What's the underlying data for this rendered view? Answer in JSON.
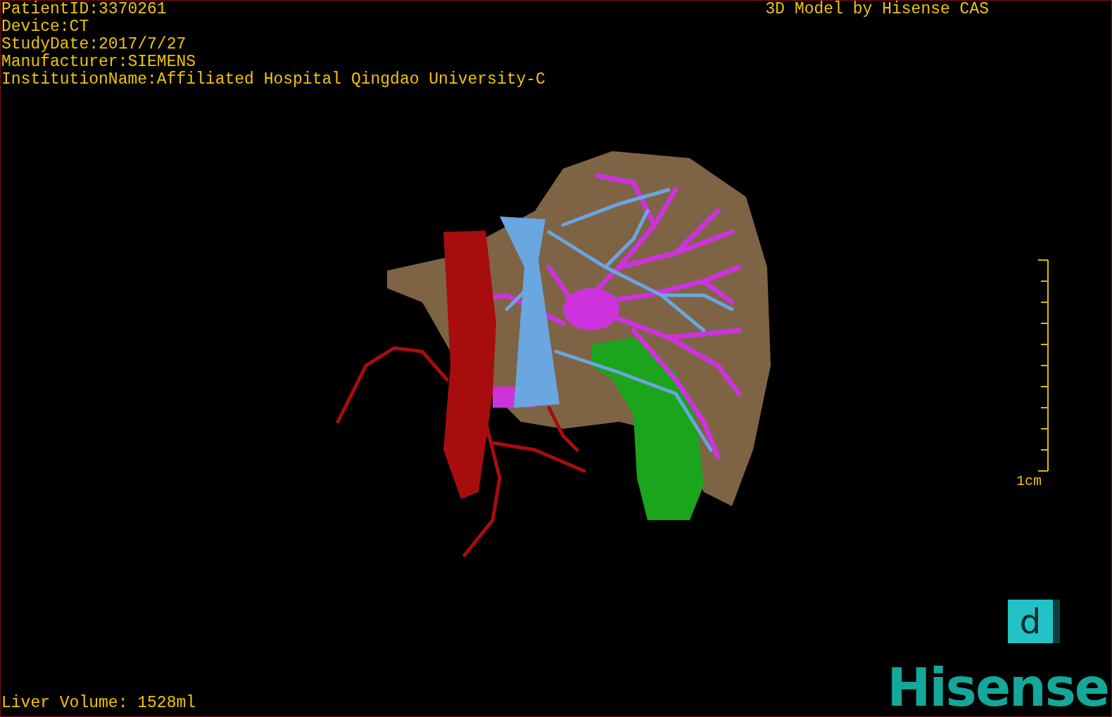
{
  "study_info": [
    "PatientID:3370261",
    "Device:CT",
    "StudyDate:2017/7/27",
    "Manufacturer:SIEMENS",
    "InstitutionName:Affiliated Hospital Qingdao University-C"
  ],
  "viewer_title": "3D Model by Hisense CAS",
  "scale_bar": {
    "label": "1cm"
  },
  "measurement": "Liver Volume: 1528ml",
  "logo": {
    "mark": "d",
    "brand": "Hisense"
  }
}
